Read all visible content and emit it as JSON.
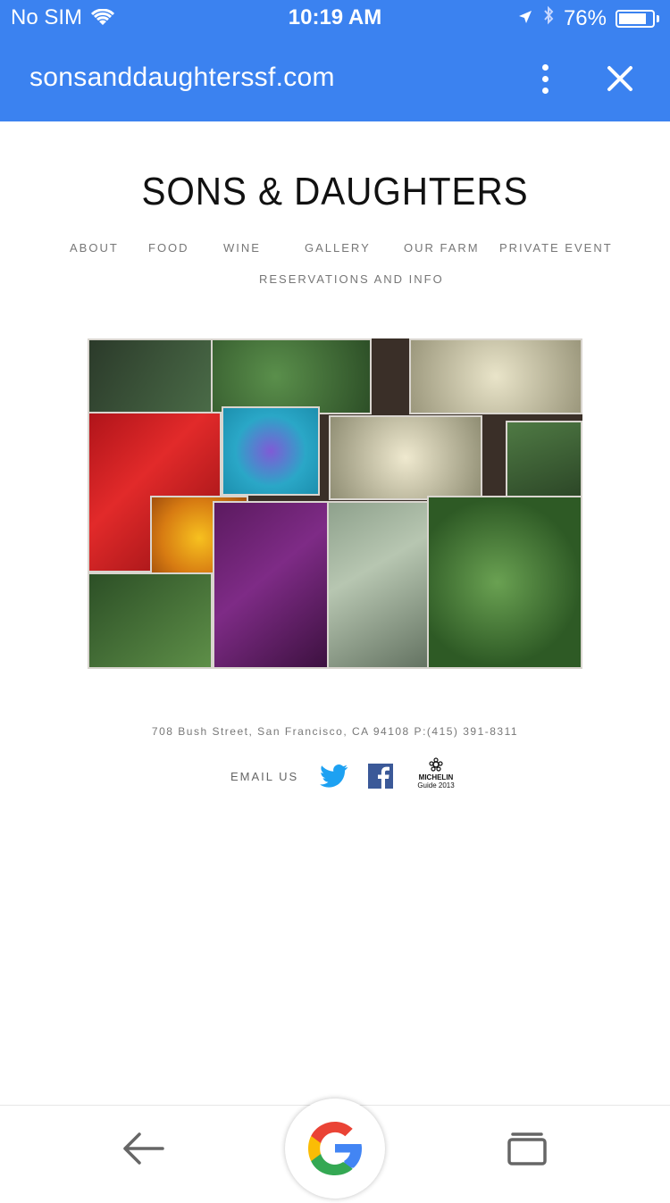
{
  "status": {
    "carrier": "No SIM",
    "time": "10:19 AM",
    "battery": "76%",
    "battery_level": 0.76
  },
  "browser": {
    "url": "sonsanddaughterssf.com",
    "icons": [
      "wifi-icon",
      "location-arrow-icon",
      "bluetooth-icon",
      "battery-icon",
      "more-vert-icon",
      "close-icon"
    ]
  },
  "site": {
    "logo": "SONS & DAUGHTERS",
    "nav": [
      {
        "label": "ABOUT"
      },
      {
        "label": "FOOD"
      },
      {
        "label": "WINE"
      },
      {
        "label": "GALLERY"
      },
      {
        "label": "OUR FARM"
      },
      {
        "label": "PRIVATE EVENT"
      },
      {
        "label": "RESERVATIONS AND INFO"
      }
    ],
    "address": "708 Bush Street, San Francisco, CA 94108   P:(415) 391-8311",
    "email": "EMAIL US",
    "michelin": {
      "line1": "MICHELIN",
      "line2": "Guide 2013"
    }
  },
  "bottom": {
    "icons": [
      "back-arrow-icon",
      "google-icon",
      "tabs-icon"
    ]
  },
  "colors": {
    "header": "#3b82f0",
    "twitter": "#1da1f2",
    "facebook": "#3b5998"
  }
}
